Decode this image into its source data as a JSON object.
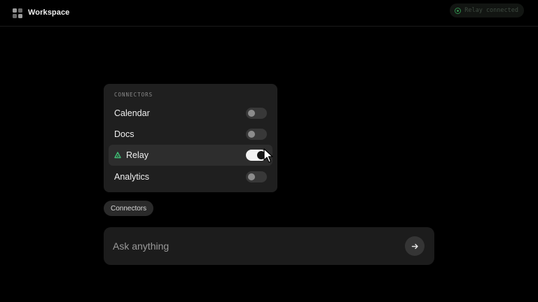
{
  "header": {
    "app_title": "Workspace",
    "status_text": "Relay connected",
    "status_icon": "check-circle-icon",
    "logo_icon": "grid-logo-icon"
  },
  "connectors_panel": {
    "heading": "CONNECTORS",
    "items": [
      {
        "label": "Calendar",
        "enabled": false
      },
      {
        "label": "Docs",
        "enabled": false
      },
      {
        "label": "Relay",
        "enabled": true,
        "icon": "relay-triangle-icon"
      },
      {
        "label": "Analytics",
        "enabled": false
      }
    ]
  },
  "chip": {
    "label": "Connectors"
  },
  "composer": {
    "placeholder": "Ask anything",
    "value": "",
    "send_icon": "arrow-right-icon"
  },
  "colors": {
    "background": "#000000",
    "panel": "#1f1f1f",
    "active_row": "#2d2d2d",
    "toggle_on": "#f2f2f2",
    "toggle_off": "#383838",
    "status_green": "#2f8a4a"
  }
}
